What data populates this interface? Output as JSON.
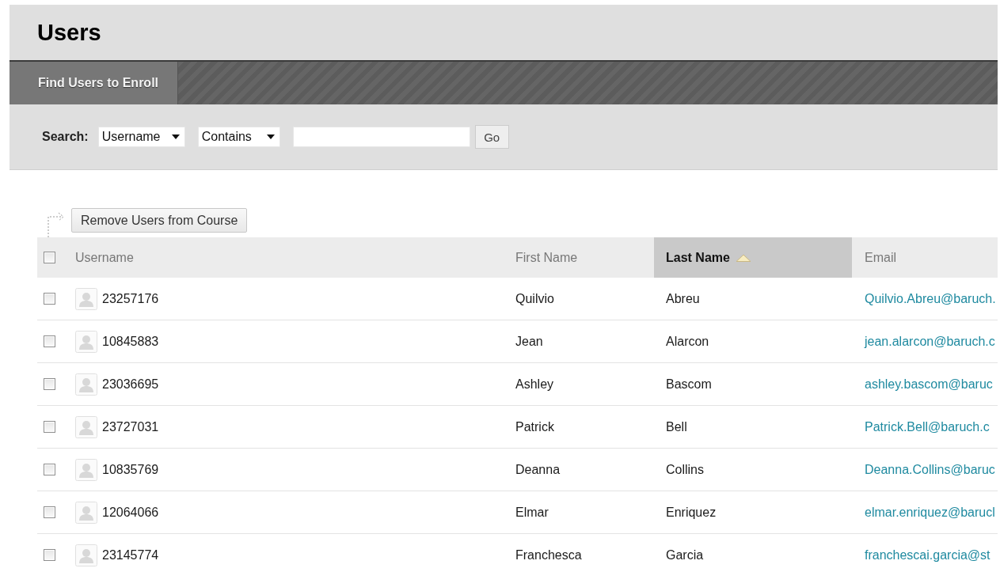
{
  "page_title": "Users",
  "tabs": [
    {
      "label": "Find Users to Enroll",
      "selected": true
    }
  ],
  "search": {
    "label": "Search:",
    "field": "Username",
    "operator": "Contains",
    "button": "Go"
  },
  "action_button": "Remove Users from Course",
  "table": {
    "select_all_checked": false,
    "columns": [
      {
        "label": "Username",
        "sorted": false
      },
      {
        "label": "First Name",
        "sorted": false
      },
      {
        "label": "Last Name",
        "sorted": true
      },
      {
        "label": "Email",
        "sorted": false
      }
    ],
    "rows": [
      {
        "checked": false,
        "username": "23257176",
        "first_name": "Quilvio",
        "last_name": "Abreu",
        "email": "Quilvio.Abreu@baruch."
      },
      {
        "checked": false,
        "username": "10845883",
        "first_name": "Jean",
        "last_name": "Alarcon",
        "email": "jean.alarcon@baruch.c"
      },
      {
        "checked": false,
        "username": "23036695",
        "first_name": "Ashley",
        "last_name": "Bascom",
        "email": "ashley.bascom@baruc"
      },
      {
        "checked": false,
        "username": "23727031",
        "first_name": "Patrick",
        "last_name": "Bell",
        "email": "Patrick.Bell@baruch.c"
      },
      {
        "checked": false,
        "username": "10835769",
        "first_name": "Deanna",
        "last_name": "Collins",
        "email": "Deanna.Collins@baruc"
      },
      {
        "checked": false,
        "username": "12064066",
        "first_name": "Elmar",
        "last_name": "Enriquez",
        "email": "elmar.enriquez@barucl"
      },
      {
        "checked": false,
        "username": "23145774",
        "first_name": "Franchesca",
        "last_name": "Garcia",
        "email": "franchescai.garcia@st"
      }
    ]
  }
}
